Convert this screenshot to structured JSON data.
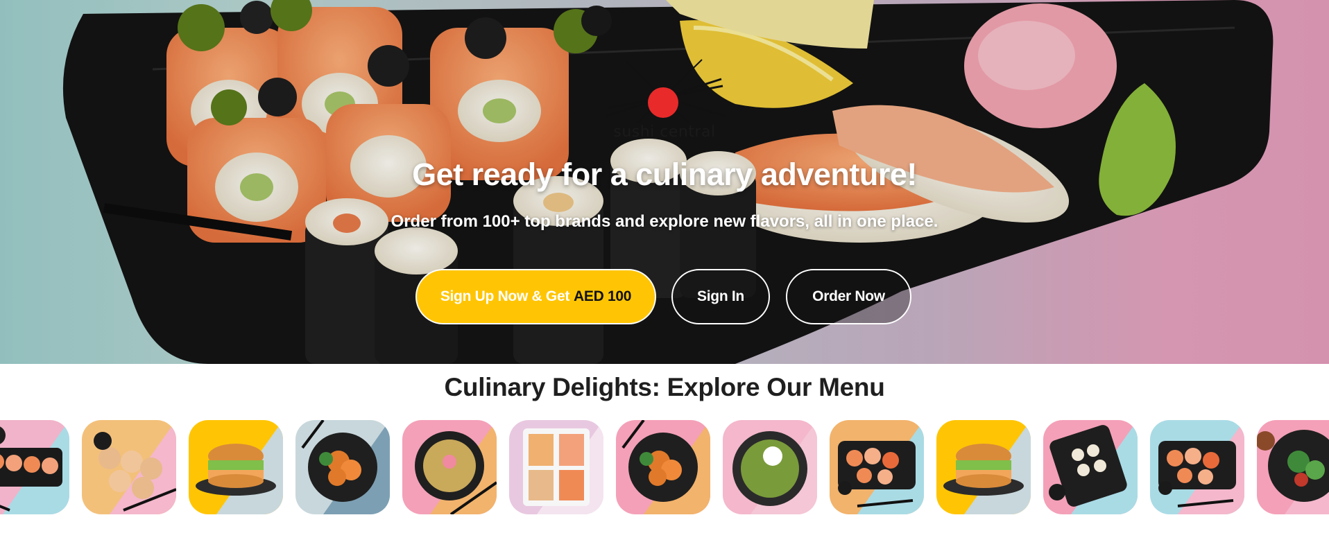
{
  "brand": {
    "logo_text": "sushi central",
    "accent": "#e82a2a"
  },
  "hero": {
    "title": "Get ready for a culinary adventure!",
    "subtitle": "Order from 100+ top brands and explore new flavors, all in one place."
  },
  "buttons": {
    "signup_label": "Sign Up Now & Get",
    "signup_amount": "AED 100",
    "signin_label": "Sign In",
    "order_label": "Order Now",
    "signup_color": "#ffc505"
  },
  "menu": {
    "title": "Culinary Delights: Explore Our Menu",
    "items": [
      {
        "name": "sushi-rolls-platter",
        "bg": [
          "#f1b3c9",
          "#a9dbe5"
        ],
        "dish": "rolls"
      },
      {
        "name": "crispy-sushi-bites",
        "bg": [
          "#f3c07a",
          "#f4b7cb"
        ],
        "dish": "bites"
      },
      {
        "name": "sushi-burger",
        "bg": [
          "#ffc505",
          "#c8d7dc"
        ],
        "dish": "burger"
      },
      {
        "name": "crispy-chicken-bowl",
        "bg": [
          "#c8d7dc",
          "#7c9fb3"
        ],
        "dish": "chicken"
      },
      {
        "name": "fried-rice-bowl",
        "bg": [
          "#f4a0b8",
          "#f2b36c"
        ],
        "dish": "rice"
      },
      {
        "name": "sushi-box-set",
        "bg": [
          "#e8c8e0",
          "#f4e4ef"
        ],
        "dish": "box"
      },
      {
        "name": "crispy-chicken-plate",
        "bg": [
          "#f4a0b8",
          "#f2b36c"
        ],
        "dish": "chicken"
      },
      {
        "name": "edamame-bowl",
        "bg": [
          "#f4b7cb",
          "#f4c6d6"
        ],
        "dish": "edamame"
      },
      {
        "name": "sushi-boat-mix",
        "bg": [
          "#f2b36c",
          "#a9dbe5"
        ],
        "dish": "mix"
      },
      {
        "name": "sushi-burger-2",
        "bg": [
          "#ffc505",
          "#c8d7dc"
        ],
        "dish": "burger"
      },
      {
        "name": "maki-tray",
        "bg": [
          "#f4a0b8",
          "#a9dbe5"
        ],
        "dish": "tray"
      },
      {
        "name": "salmon-platter",
        "bg": [
          "#a9dbe5",
          "#f4b7cb"
        ],
        "dish": "mix"
      },
      {
        "name": "salad-bowl",
        "bg": [
          "#f4a0b8",
          "#f4b7cb"
        ],
        "dish": "salad"
      }
    ]
  }
}
